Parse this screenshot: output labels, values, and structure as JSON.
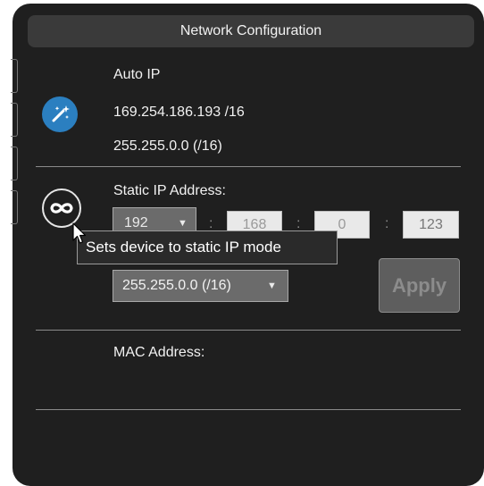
{
  "header": {
    "title": "Network Configuration"
  },
  "auto_ip": {
    "label": "Auto IP",
    "address": "169.254.186.193 /16",
    "mask": "255.255.0.0 (/16)",
    "icon": "magic-wand-icon"
  },
  "static_ip": {
    "label": "Static IP Address:",
    "icon": "infinity-icon",
    "octets": [
      "192",
      "168",
      "0",
      "123"
    ],
    "separator": ":",
    "mask_selected": "255.255.0.0 (/16)",
    "apply_label": "Apply",
    "tooltip": "Sets device to static IP mode"
  },
  "mac": {
    "label": "MAC Address:",
    "value": ""
  },
  "colors": {
    "panel": "#1f1f1f",
    "header": "#3a3a3a",
    "accent": "#2b7fc0"
  }
}
